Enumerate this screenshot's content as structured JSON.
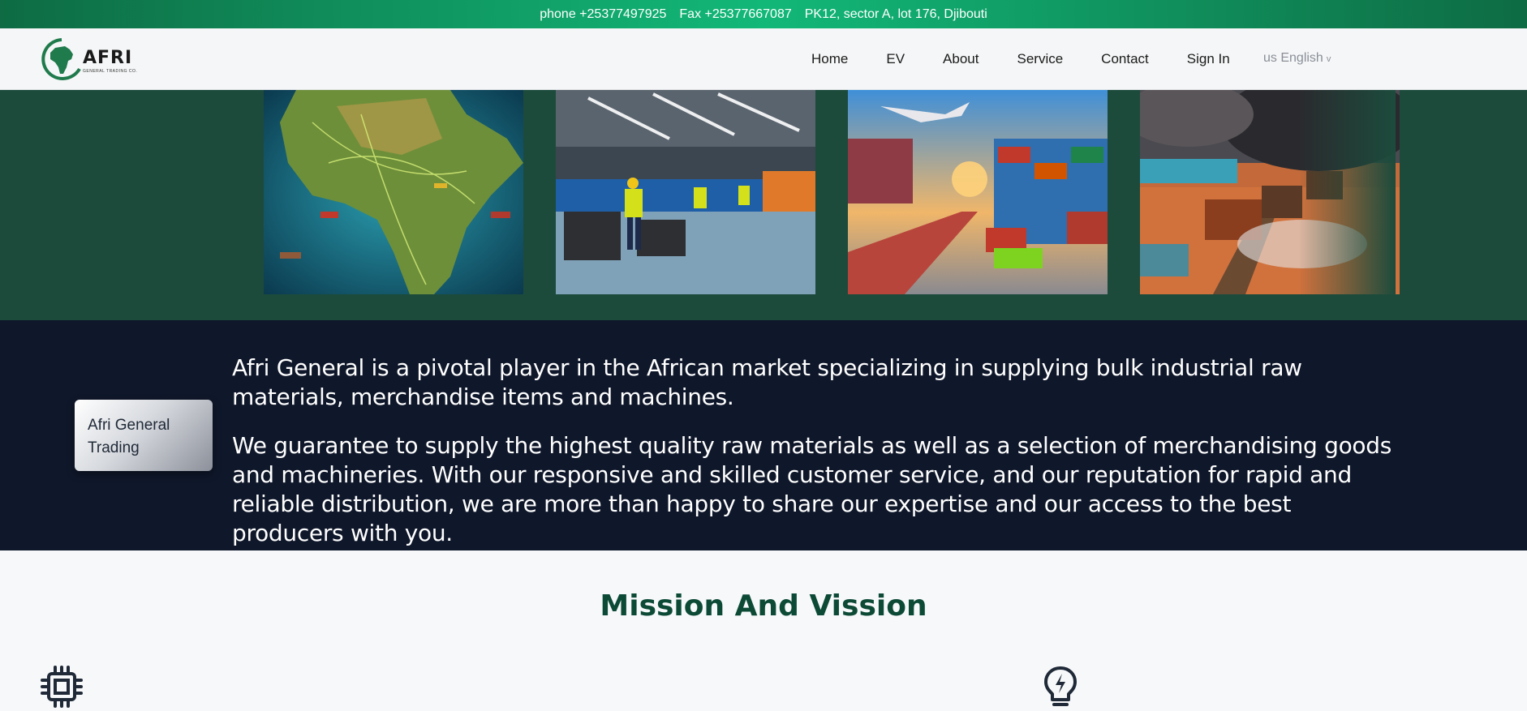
{
  "topbar": {
    "phone": "phone +25377497925",
    "fax": "Fax +25377667087",
    "address": "PK12, sector A, lot 176, Djibouti"
  },
  "logo": {
    "name": "AFRI",
    "subtitle": "GENERAL TRADING CO.",
    "icon": "africa-logo-icon",
    "color": "#1f7a4c"
  },
  "nav": {
    "items": [
      {
        "label": "Home"
      },
      {
        "label": "EV"
      },
      {
        "label": "About"
      },
      {
        "label": "Service"
      },
      {
        "label": "Contact"
      },
      {
        "label": "Sign In"
      }
    ],
    "language": "us English",
    "language_chevron": "v"
  },
  "hero": {
    "images": [
      {
        "name": "africa-trade-map-image"
      },
      {
        "name": "warehouse-workers-image"
      },
      {
        "name": "container-port-airplane-image"
      },
      {
        "name": "desert-freight-train-image"
      }
    ]
  },
  "about": {
    "badge": "Afri General Trading",
    "paragraph1": "Afri General is a pivotal player in the African market specializing in supplying bulk industrial raw materials, merchandise items and machines.",
    "paragraph2": "We guarantee to supply the highest quality raw materials as well as a selection of merchandising goods and machineries. With our responsive and skilled customer service, and our reputation for rapid and reliable distribution, we are more than happy to share our expertise and our access to the best producers with you."
  },
  "mission": {
    "title": "Mission And Vission",
    "icons": [
      "cpu-chip-icon",
      "lightbulb-bolt-icon"
    ]
  },
  "colors": {
    "accent": "#12b878",
    "brand_dark": "#0c4a36",
    "hero_bg": "#1c4b3c",
    "about_bg": "#0f172a"
  }
}
